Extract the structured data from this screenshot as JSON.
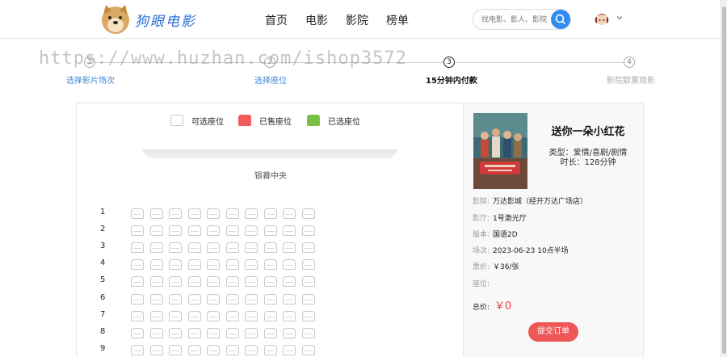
{
  "header": {
    "brand": "狗眼电影",
    "nav": [
      "首页",
      "电影",
      "影院",
      "榜单"
    ],
    "search_placeholder": "找电影、影人、影院"
  },
  "watermark": "https://www.huzhan.com/ishop3572",
  "steps": [
    {
      "num": "1",
      "label": "选择影片场次",
      "state": "done"
    },
    {
      "num": "2",
      "label": "选择座位",
      "state": "done"
    },
    {
      "num": "3",
      "label": "15分钟内付款",
      "state": "active"
    },
    {
      "num": "4",
      "label": "影院取票观影",
      "state": "todo"
    }
  ],
  "legend": {
    "available": "可选座位",
    "sold": "已售座位",
    "selected": "已选座位",
    "sold_color": "#f05b5b",
    "selected_color": "#7ac143"
  },
  "screen_label": "银幕中央",
  "rows": [
    "1",
    "2",
    "3",
    "4",
    "5",
    "6",
    "7",
    "8",
    "9"
  ],
  "movie": {
    "title": "送你一朵小红花",
    "type_label": "类型：爱情/喜剧/剧情",
    "duration_label": "时长：128分钟",
    "info": [
      {
        "key": "影院:",
        "value": "万达影城（经开万达广场店）"
      },
      {
        "key": "影厅:",
        "value": "1号激光厅"
      },
      {
        "key": "版本:",
        "value": "国语2D"
      },
      {
        "key": "场次:",
        "value": "2023-06-23 10点半场"
      },
      {
        "key": "票价:",
        "value": "￥36/张"
      },
      {
        "key": "座位:",
        "value": ""
      }
    ],
    "total_label": "总价:",
    "total_value": "￥0",
    "submit_label": "提交订单"
  }
}
